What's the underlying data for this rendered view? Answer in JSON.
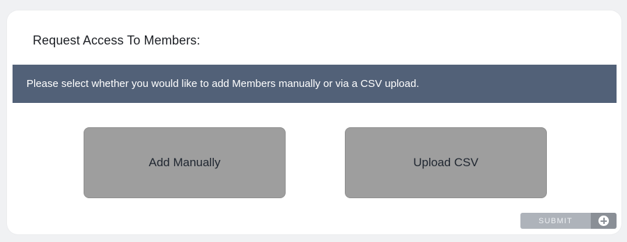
{
  "form": {
    "title": "Request Access To Members:",
    "info": "Please select whether you would like to add Members manually or via a CSV upload.",
    "options": [
      {
        "label": "Add Manually"
      },
      {
        "label": "Upload CSV"
      }
    ],
    "submit_label": "SUBMIT",
    "submit_icon": "plus-circle-icon"
  },
  "colors": {
    "banner": "#526178",
    "option_button": "#9e9e9e",
    "submit_label_bg": "#aeb3ba",
    "submit_icon_bg": "#8a8f96"
  }
}
